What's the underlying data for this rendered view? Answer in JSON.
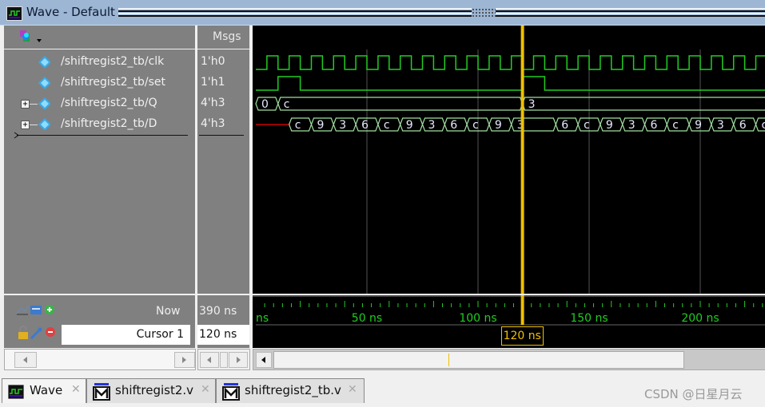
{
  "window": {
    "title": "Wave - Default"
  },
  "header": {
    "msgs_label": "Msgs"
  },
  "signals": [
    {
      "name": "/shiftregist2_tb/clk",
      "value": "1'h0",
      "expandable": false
    },
    {
      "name": "/shiftregist2_tb/set",
      "value": "1'h1",
      "expandable": false
    },
    {
      "name": "/shiftregist2_tb/Q",
      "value": "4'h3",
      "expandable": true
    },
    {
      "name": "/shiftregist2_tb/D",
      "value": "4'h3",
      "expandable": true
    }
  ],
  "waveforms": {
    "time_unit": "ns",
    "clk": {
      "first_rise_ns": 5,
      "period_ns": 10,
      "initial": 0
    },
    "set": {
      "initial": 0,
      "edges_ns": [
        [
          10,
          1
        ],
        [
          20,
          0
        ],
        [
          120,
          1
        ],
        [
          130,
          0
        ]
      ]
    },
    "Q": [
      {
        "start": 0,
        "end": 10,
        "v": "0"
      },
      {
        "start": 10,
        "end": 120,
        "v": "c"
      },
      {
        "start": 120,
        "end": 240,
        "v": "3"
      }
    ],
    "D": {
      "undefined_until_ns": 15,
      "segments": [
        {
          "start": 15,
          "end": 25,
          "v": "c"
        },
        {
          "start": 25,
          "end": 35,
          "v": "9"
        },
        {
          "start": 35,
          "end": 45,
          "v": "3"
        },
        {
          "start": 45,
          "end": 55,
          "v": "6"
        },
        {
          "start": 55,
          "end": 65,
          "v": "c"
        },
        {
          "start": 65,
          "end": 75,
          "v": "9"
        },
        {
          "start": 75,
          "end": 85,
          "v": "3"
        },
        {
          "start": 85,
          "end": 95,
          "v": "6"
        },
        {
          "start": 95,
          "end": 105,
          "v": "c"
        },
        {
          "start": 105,
          "end": 115,
          "v": "9"
        },
        {
          "start": 115,
          "end": 135,
          "v": "3"
        },
        {
          "start": 135,
          "end": 145,
          "v": "6"
        },
        {
          "start": 145,
          "end": 155,
          "v": "c"
        },
        {
          "start": 155,
          "end": 165,
          "v": "9"
        },
        {
          "start": 165,
          "end": 175,
          "v": "3"
        },
        {
          "start": 175,
          "end": 185,
          "v": "6"
        },
        {
          "start": 185,
          "end": 195,
          "v": "c"
        },
        {
          "start": 195,
          "end": 205,
          "v": "9"
        },
        {
          "start": 205,
          "end": 215,
          "v": "3"
        },
        {
          "start": 215,
          "end": 225,
          "v": "6"
        },
        {
          "start": 225,
          "end": 240,
          "v": "c"
        }
      ]
    },
    "grid_ns": [
      50,
      100,
      150,
      200
    ],
    "view_start_ns": 0,
    "view_end_ns": 230
  },
  "time_axis": {
    "labels": [
      {
        "t": 0,
        "text": "ns"
      },
      {
        "t": 50,
        "text": "50 ns"
      },
      {
        "t": 100,
        "text": "100 ns"
      },
      {
        "t": 150,
        "text": "150 ns"
      },
      {
        "t": 200,
        "text": "200 ns"
      }
    ],
    "major_tick_ns": 10,
    "minor_tick_ns": 2
  },
  "now": {
    "label": "Now",
    "value": "390 ns"
  },
  "cursor": {
    "label": "Cursor 1",
    "value": "120 ns",
    "time_ns": 120,
    "flag_text": "120 ns"
  },
  "colors": {
    "wave": "#22cc22",
    "bus": "#a0e0a0",
    "cursor": "#f0c000",
    "undefined": "#cc0000",
    "grid": "#555555"
  },
  "tabs": [
    {
      "label": "Wave",
      "active": true,
      "icon": "wave-icon"
    },
    {
      "label": "shiftregist2.v",
      "active": false,
      "icon": "modelsim-icon"
    },
    {
      "label": "shiftregist2_tb.v",
      "active": false,
      "icon": "modelsim-icon"
    }
  ],
  "watermark": "CSDN @日星月云"
}
